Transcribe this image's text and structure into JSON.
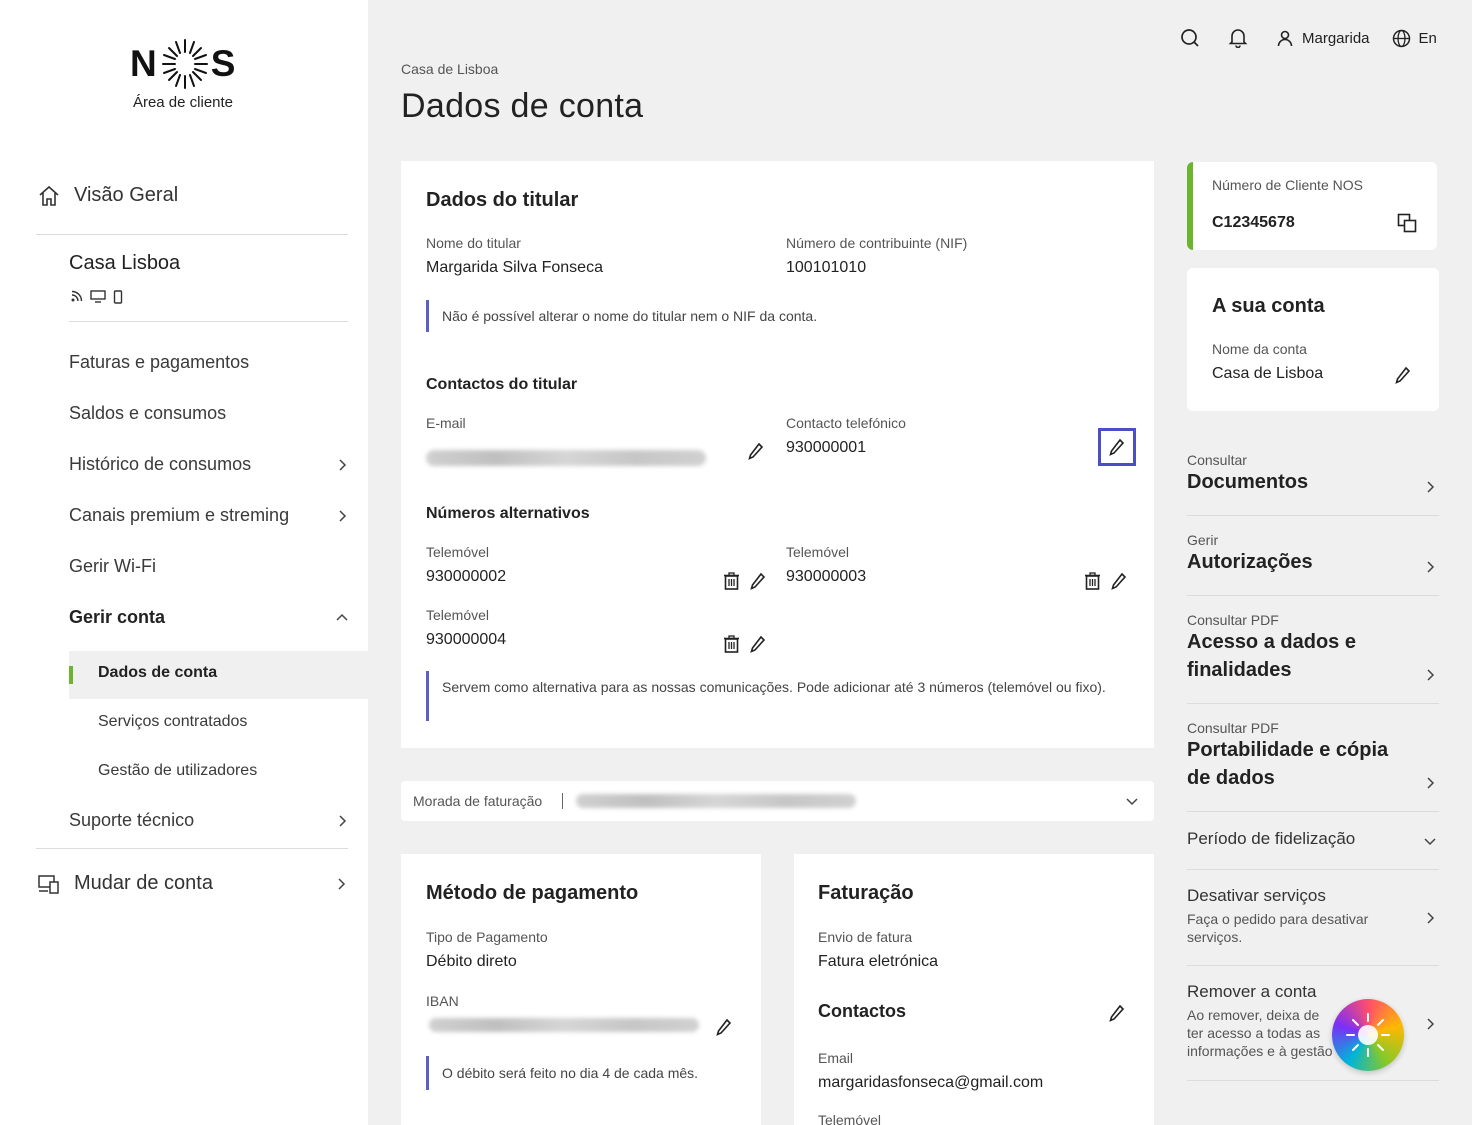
{
  "brand": {
    "logo_left": "N",
    "logo_right": "S",
    "subtitle": "Área de cliente"
  },
  "sidebar": {
    "overview": "Visão Geral",
    "account_name": "Casa Lisboa",
    "items": [
      {
        "label": "Faturas e pagamentos"
      },
      {
        "label": "Saldos e consumos"
      },
      {
        "label": "Histórico de consumos"
      },
      {
        "label": "Canais premium e streming"
      },
      {
        "label": "Gerir Wi-Fi"
      },
      {
        "label": "Gerir conta"
      }
    ],
    "subitems": [
      {
        "label": "Dados de conta"
      },
      {
        "label": "Serviços contratados"
      },
      {
        "label": "Gestão de utilizadores"
      }
    ],
    "support": "Suporte técnico",
    "switch_account": "Mudar de conta",
    "accent": "#6bb52d"
  },
  "topbar": {
    "user": "Margarida",
    "lang": "En"
  },
  "header": {
    "breadcrumb": "Casa de Lisboa",
    "title": "Dados de conta"
  },
  "holder": {
    "title": "Dados do titular",
    "name_label": "Nome do titular",
    "name_value": "Margarida Silva Fonseca",
    "nif_label": "Número de contribuinte (NIF)",
    "nif_value": "100101010",
    "note": "Não é possível alterar o nome do titular nem o NIF da conta.",
    "contacts_title": "Contactos do titular",
    "email_label": "E-mail",
    "phone_label": "Contacto telefónico",
    "phone_value": "930000001",
    "alt_title": "Números alternativos",
    "alt": [
      {
        "label": "Telemóvel",
        "value": "930000002"
      },
      {
        "label": "Telemóvel",
        "value": "930000003"
      },
      {
        "label": "Telemóvel",
        "value": "930000004"
      }
    ],
    "alt_note": "Servem como alternativa para as nossas comunicações. Pode adicionar até 3 números (telemóvel ou fixo)."
  },
  "billing_address": {
    "label": "Morada de faturação"
  },
  "payment": {
    "title": "Método de pagamento",
    "type_label": "Tipo de Pagamento",
    "type_value": "Débito direto",
    "iban_label": "IBAN",
    "note": "O débito será feito no dia 4 de cada mês."
  },
  "invoicing": {
    "title": "Faturação",
    "send_label": "Envio de fatura",
    "send_value": "Fatura eletrónica",
    "contacts_title": "Contactos",
    "email_label": "Email",
    "email_value": "margaridasfonseca@gmail.com",
    "mobile_label": "Telemóvel"
  },
  "right": {
    "client_label": "Número de Cliente NOS",
    "client_value": "C12345678",
    "account_title": "A sua conta",
    "account_name_label": "Nome da conta",
    "account_name_value": "Casa de Lisboa",
    "links": [
      {
        "small": "Consultar",
        "big": "Documentos"
      },
      {
        "small": "Gerir",
        "big": "Autorizações"
      },
      {
        "small": "Consultar PDF",
        "big": "Acesso a dados e finalidades"
      },
      {
        "small": "Consultar PDF",
        "big": "Portabilidade e cópia de dados"
      }
    ],
    "loyalty": "Período de fidelização",
    "deactivate_title": "Desativar serviços",
    "deactivate_desc": "Faça o pedido para desativar serviços.",
    "remove_title": "Remover a conta",
    "remove_desc": "Ao remover, deixa de ter acesso a todas as informações e à gestão da sua conta."
  }
}
